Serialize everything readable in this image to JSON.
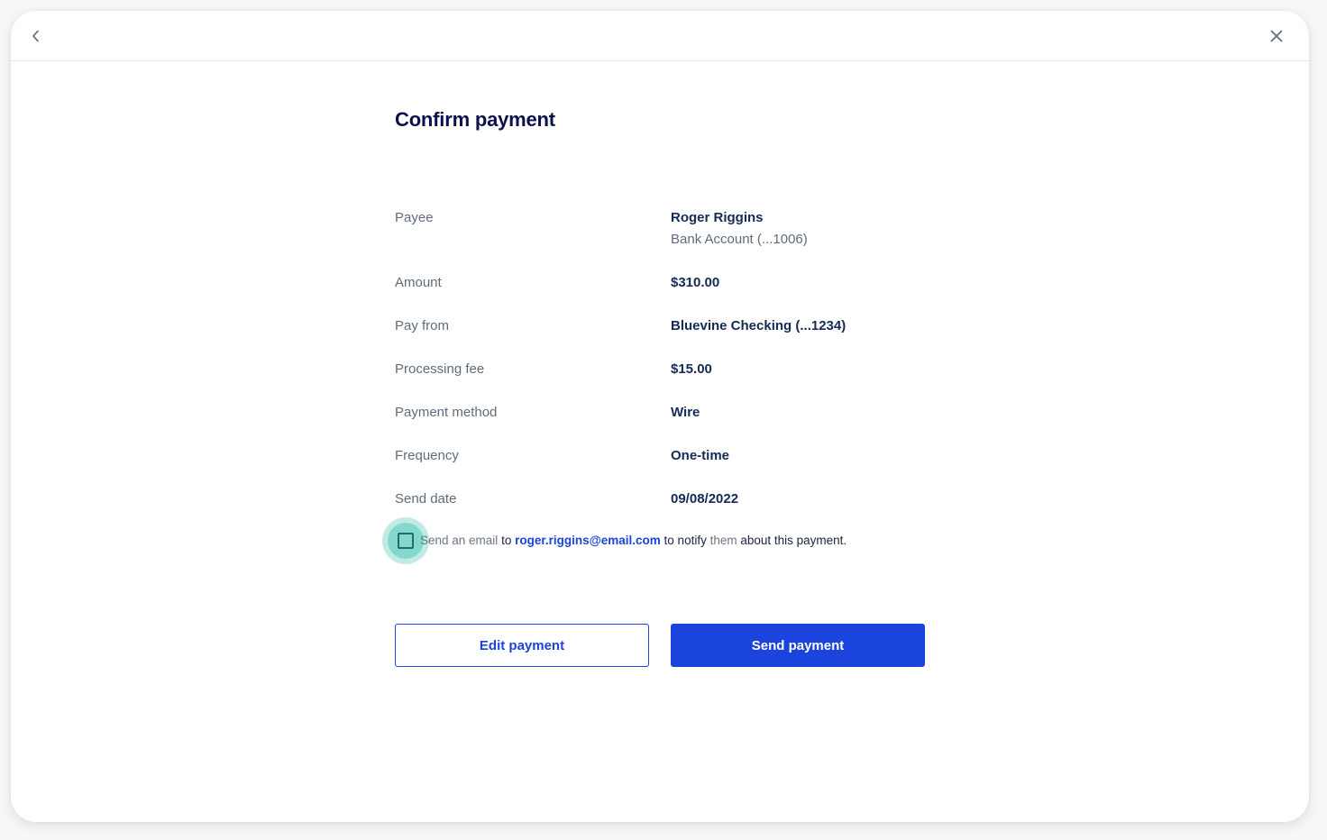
{
  "header": {
    "back_icon": "chevron-left-icon",
    "close_icon": "close-icon"
  },
  "title": "Confirm payment",
  "details": [
    {
      "label": "Payee",
      "value": "Roger Riggins",
      "subvalue": "Bank Account (...1006)"
    },
    {
      "label": "Amount",
      "value": "$310.00"
    },
    {
      "label": "Pay from",
      "value": "Bluevine Checking (...1234)"
    },
    {
      "label": "Processing fee",
      "value": "$15.00"
    },
    {
      "label": "Payment method",
      "value": "Wire"
    },
    {
      "label": "Frequency",
      "value": "One-time"
    },
    {
      "label": "Send date",
      "value": "09/08/2022"
    }
  ],
  "notify": {
    "checked": false,
    "part1": "Send an email",
    "part2": " to ",
    "email": "roger.riggins@email.com",
    "part3": " to notify ",
    "part4": "them",
    "part5": " about this payment."
  },
  "buttons": {
    "edit": "Edit payment",
    "send": "Send payment"
  },
  "colors": {
    "primary": "#1b44dd",
    "title": "#0c114d",
    "checkbox_focus": "#85d8cc"
  }
}
